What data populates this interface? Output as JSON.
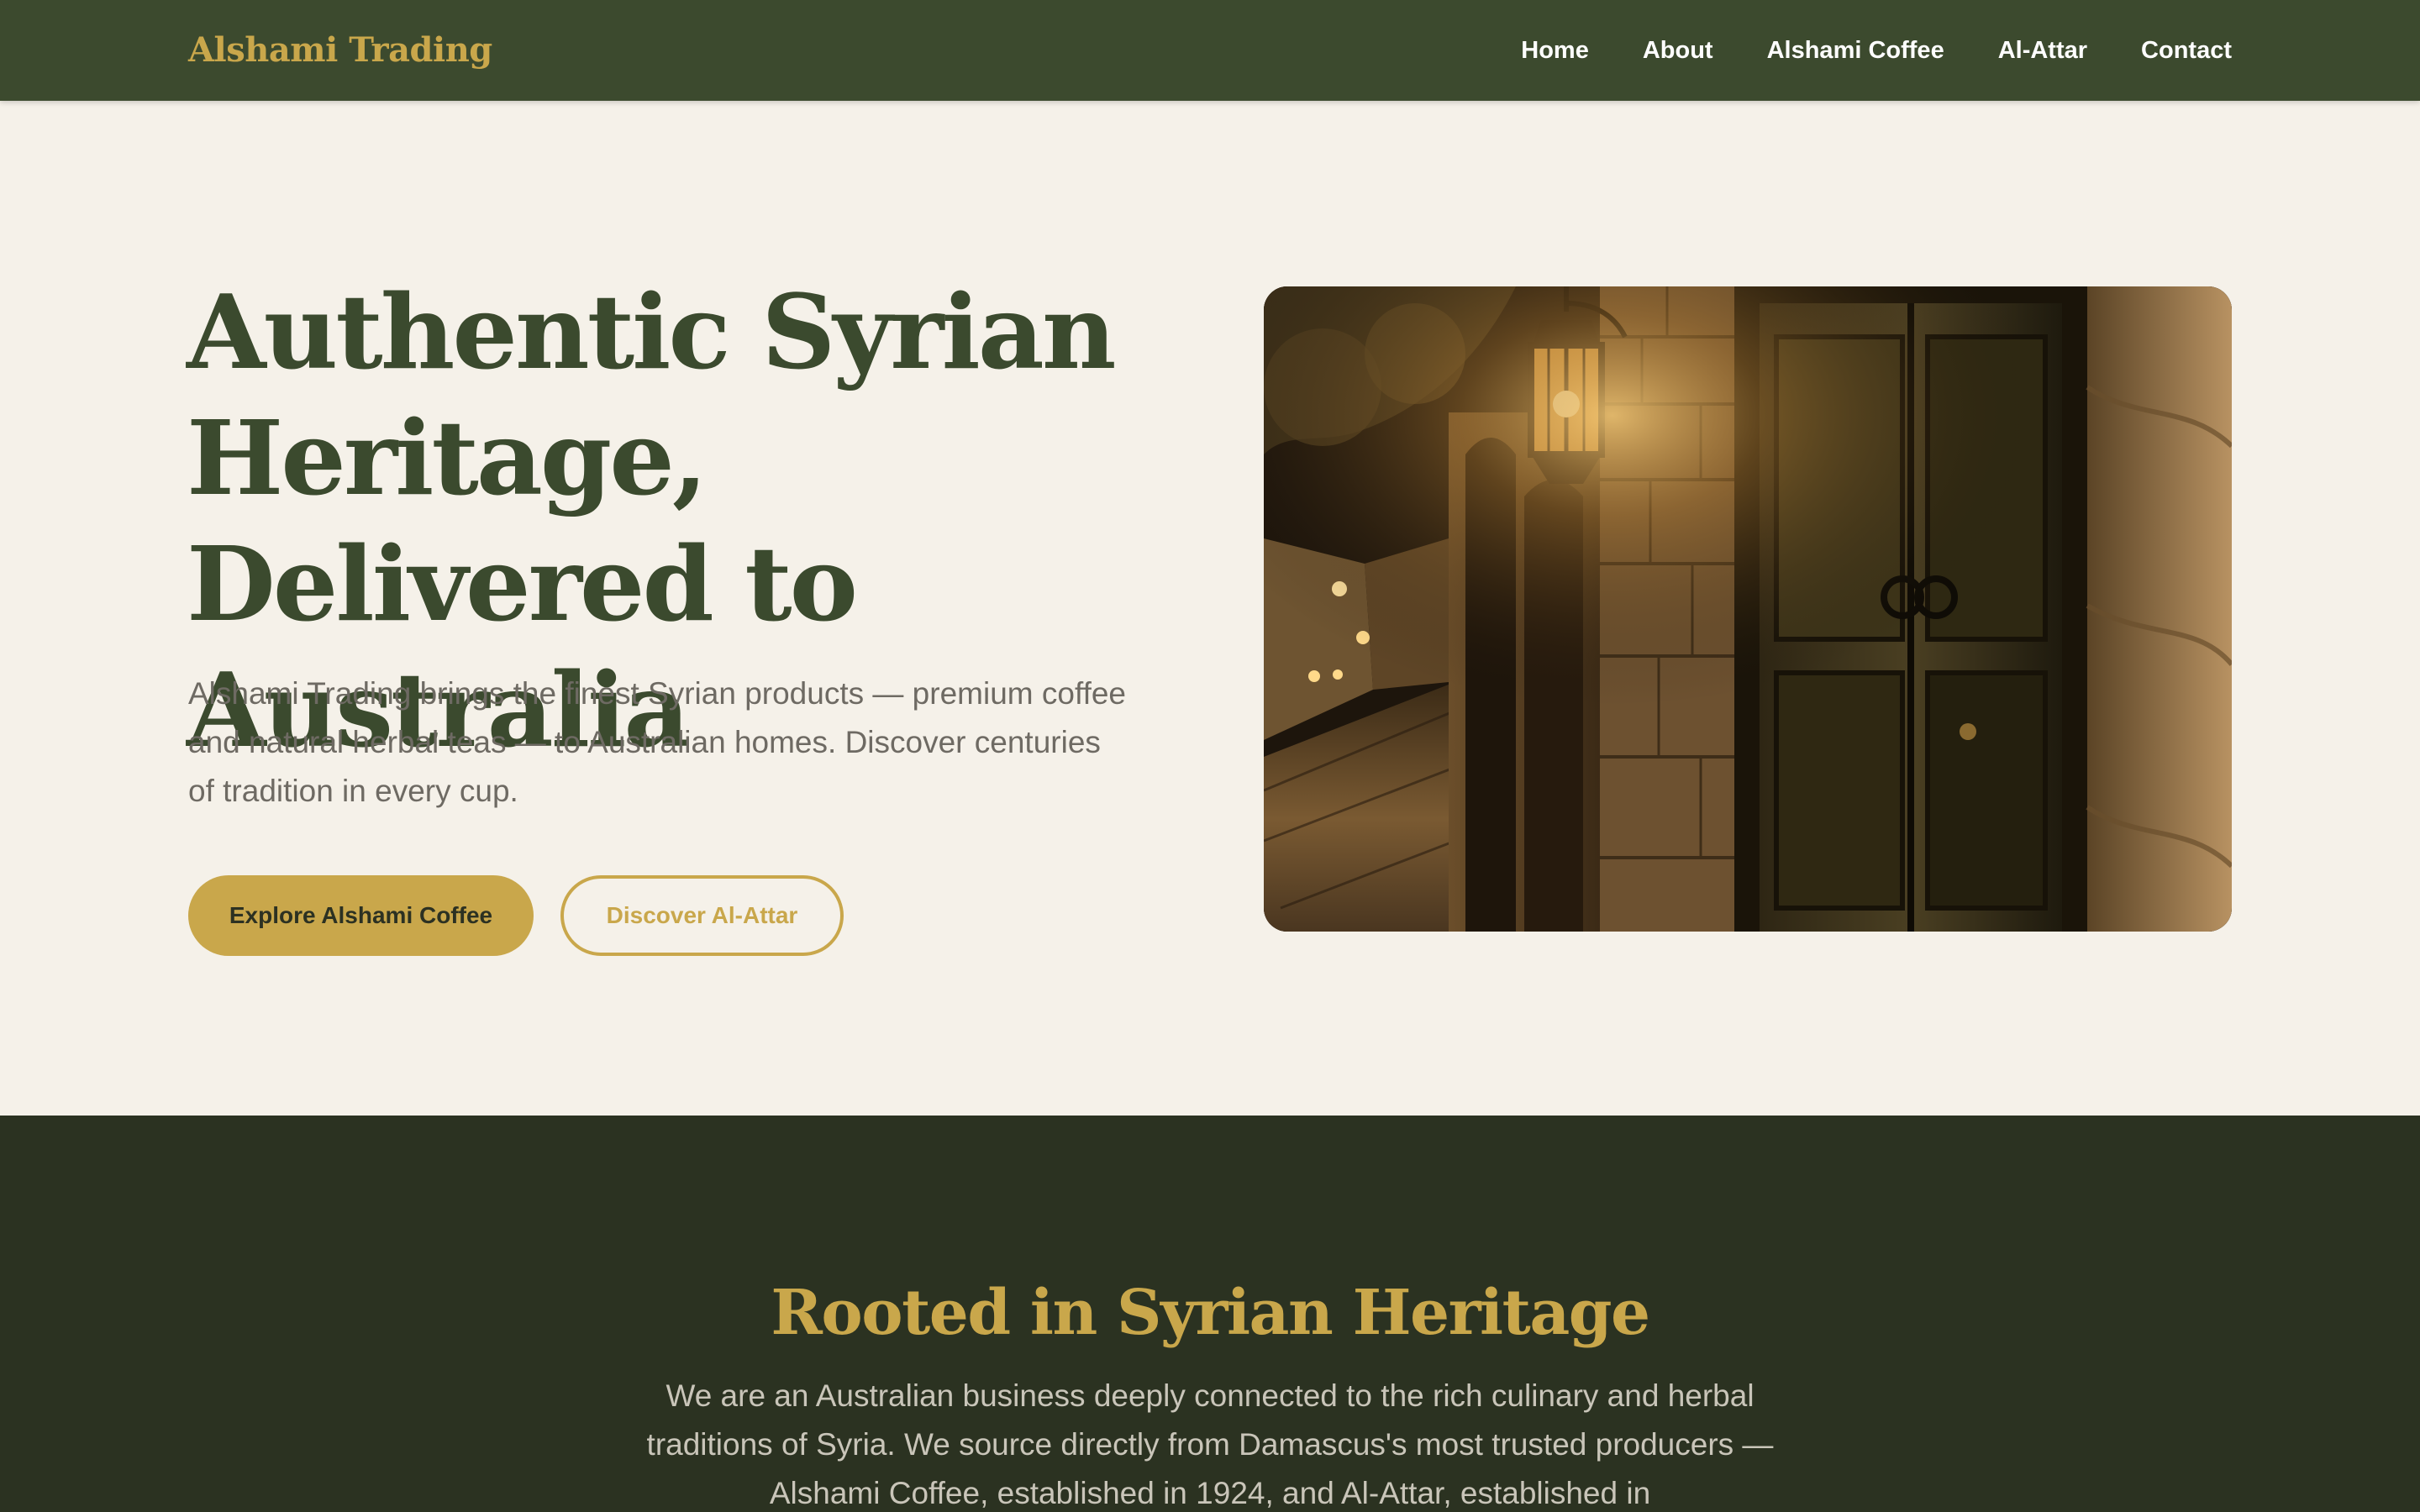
{
  "nav": {
    "brand": "Alshami Trading",
    "links": [
      "Home",
      "About",
      "Alshami Coffee",
      "Al-Attar",
      "Contact"
    ]
  },
  "hero": {
    "title": "Authentic Syrian Heritage, Delivered to Australia",
    "subtitle": "Alshami Trading brings the finest Syrian products — premium coffee and natural herbal teas — to Australian homes. Discover centuries of tradition in every cup.",
    "primary_button": "Explore Alshami Coffee",
    "secondary_button": "Discover Al-Attar"
  },
  "about": {
    "title": "Rooted in Syrian Heritage",
    "text": "We are an Australian business deeply connected to the rich culinary and herbal traditions of Syria. We source directly from Damascus's most trusted producers — Alshami Coffee, established in 1924, and Al-Attar, established in"
  },
  "colors": {
    "nav_bg": "#3c4a2e",
    "accent_gold": "#c9a74b",
    "hero_bg": "#f5f1e9",
    "heading_green": "#3b4a2e",
    "about_bg": "#2b3221"
  }
}
